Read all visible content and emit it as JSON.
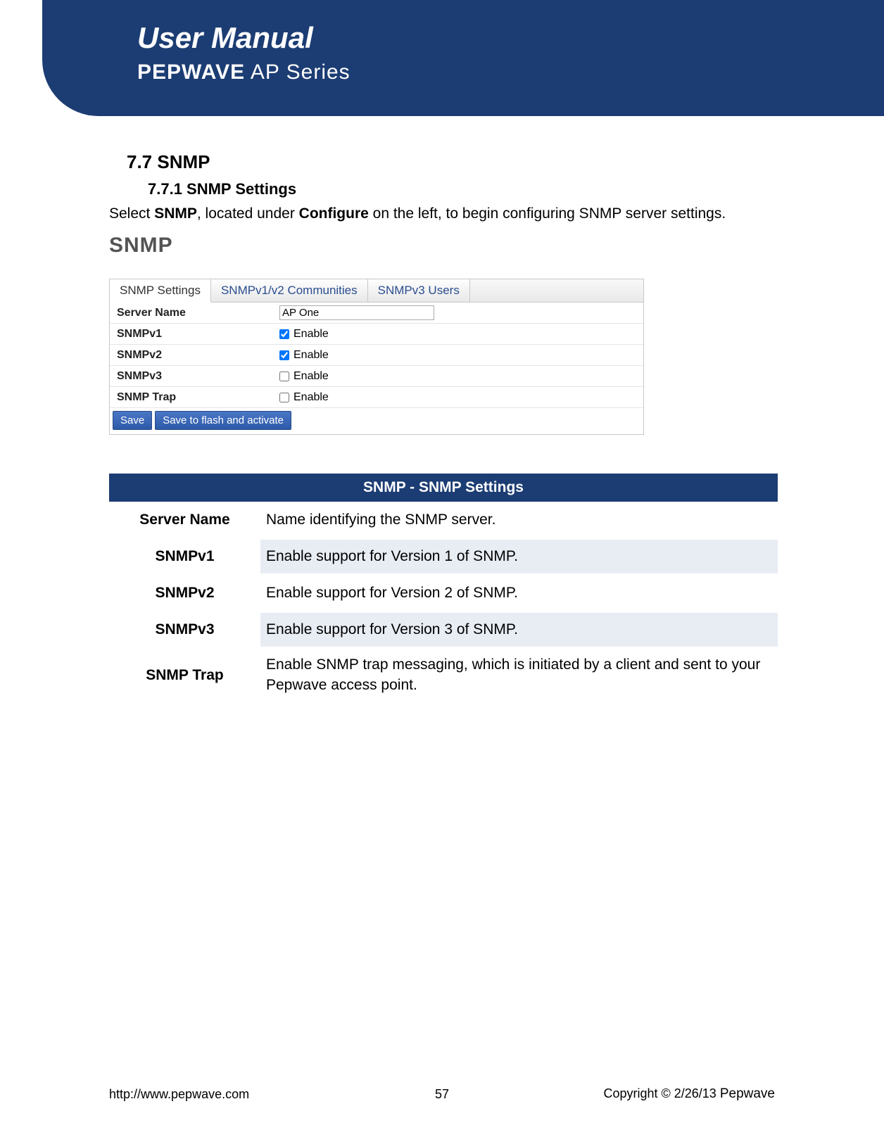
{
  "header": {
    "title": "User Manual",
    "brand_bold": "PEPWAVE",
    "brand_light": " AP Series"
  },
  "section": {
    "heading": "7.7 SNMP",
    "subheading": "7.7.1 SNMP Settings",
    "intro_pre": "Select ",
    "intro_b1": "SNMP",
    "intro_mid": ", located under ",
    "intro_b2": "Configure",
    "intro_post": " on the left, to begin configuring SNMP server settings."
  },
  "panel": {
    "title": "SNMP",
    "tabs": [
      "SNMP Settings",
      "SNMPv1/v2 Communities",
      "SNMPv3 Users"
    ],
    "rows": {
      "server_name": {
        "label": "Server Name",
        "value": "AP One"
      },
      "snmpv1": {
        "label": "SNMPv1",
        "checked": true,
        "text": "Enable"
      },
      "snmpv2": {
        "label": "SNMPv2",
        "checked": true,
        "text": "Enable"
      },
      "snmpv3": {
        "label": "SNMPv3",
        "checked": false,
        "text": "Enable"
      },
      "snmptrap": {
        "label": "SNMP Trap",
        "checked": false,
        "text": "Enable"
      }
    },
    "buttons": {
      "save": "Save",
      "activate": "Save to flash and activate"
    }
  },
  "desc_table": {
    "header": "SNMP - SNMP Settings",
    "rows": [
      {
        "label": "Server Name",
        "desc": "Name identifying the SNMP server.",
        "shaded": false
      },
      {
        "label": "SNMPv1",
        "desc": "Enable support for Version 1 of SNMP.",
        "shaded": true
      },
      {
        "label": "SNMPv2",
        "desc": "Enable support for Version 2 of SNMP.",
        "shaded": false
      },
      {
        "label": "SNMPv3",
        "desc": "Enable support for Version 3 of SNMP.",
        "shaded": true
      },
      {
        "label": "SNMP Trap",
        "desc": "Enable SNMP trap messaging, which is initiated by a client and sent to your Pepwave access point.",
        "shaded": false
      }
    ]
  },
  "footer": {
    "url": "http://www.pepwave.com",
    "page": "57",
    "copyright_pre": "Copyright © ",
    "copyright_date": "2/26/13 ",
    "copyright_brand": "Pepwave"
  }
}
